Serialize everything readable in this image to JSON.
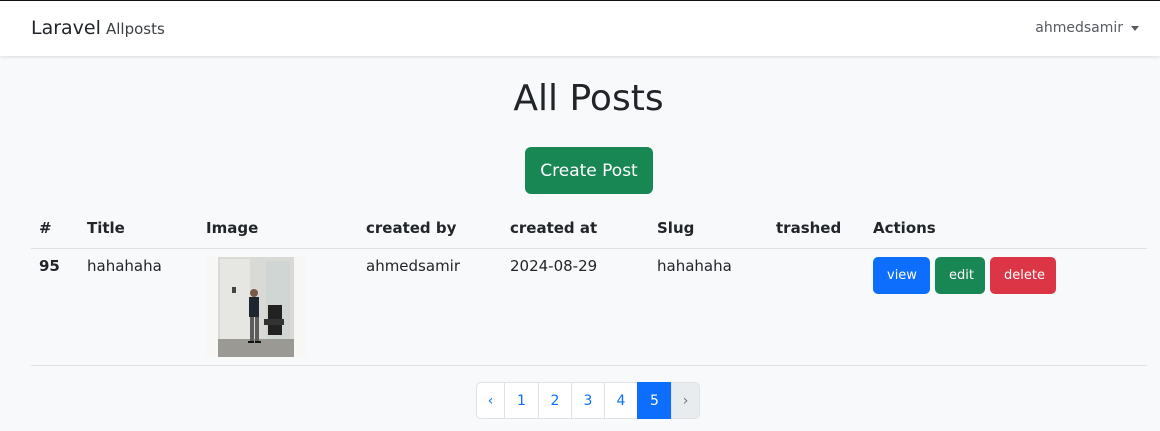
{
  "navbar": {
    "brand": "Laravel",
    "links": [
      "Allposts"
    ],
    "user": "ahmedsamir"
  },
  "page": {
    "title": "All Posts",
    "create_button": "Create Post"
  },
  "table": {
    "headers": [
      "#",
      "Title",
      "Image",
      "created by",
      "created at",
      "Slug",
      "trashed",
      "Actions"
    ],
    "rows": [
      {
        "id": "95",
        "title": "hahahaha",
        "image": "post-thumbnail",
        "created_by": "ahmedsamir",
        "created_at": "2024-08-29",
        "slug": "hahahaha",
        "trashed": ""
      }
    ],
    "actions": {
      "view": "view",
      "edit": "edit",
      "delete": "delete"
    }
  },
  "pagination": {
    "prev": "‹",
    "pages": [
      "1",
      "2",
      "3",
      "4",
      "5"
    ],
    "current": "5",
    "next": "›"
  },
  "colors": {
    "primary": "#0d6efd",
    "success": "#198754",
    "danger": "#dc3545",
    "background": "#f8f9fa"
  }
}
